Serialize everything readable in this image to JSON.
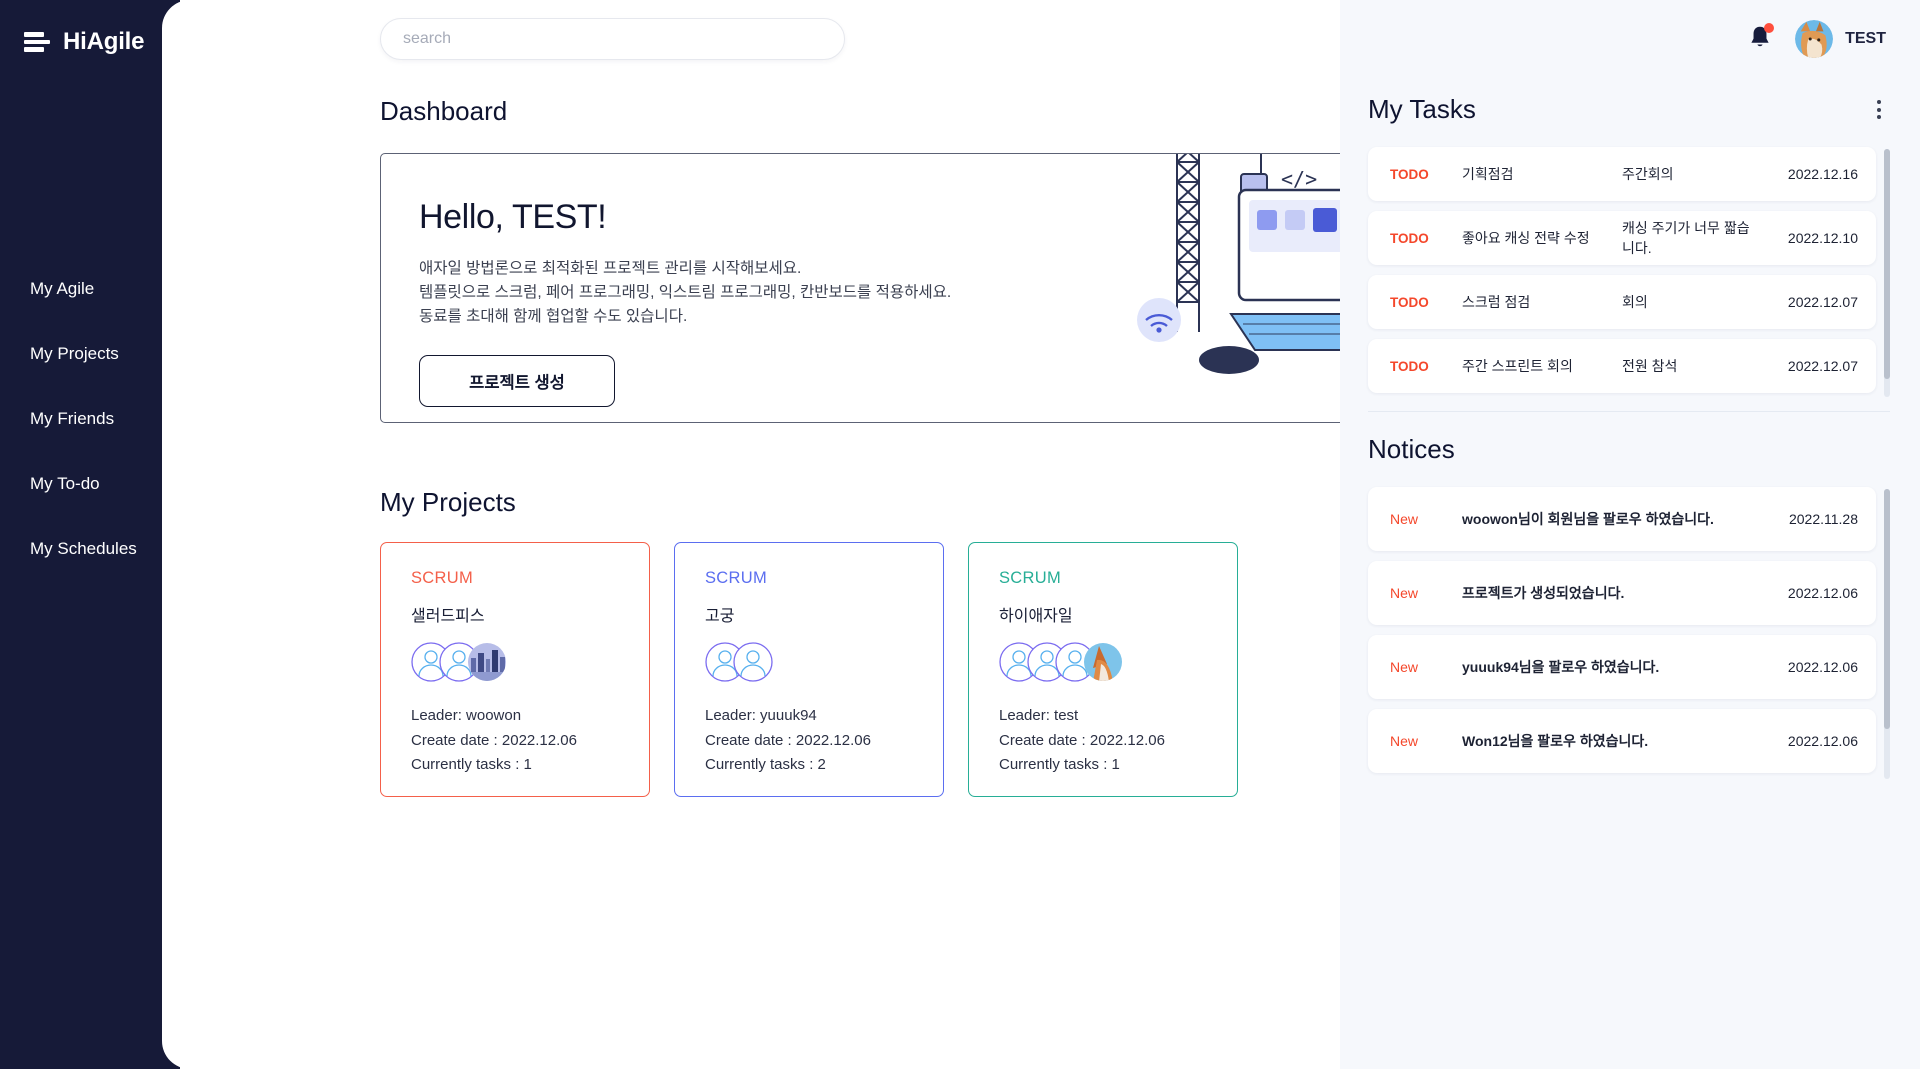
{
  "brand": {
    "name": "HiAgile",
    "icon": "stacked-bars-icon"
  },
  "sidebar": {
    "items": [
      {
        "label": "My Agile"
      },
      {
        "label": "My Projects"
      },
      {
        "label": "My Friends"
      },
      {
        "label": "My To-do"
      },
      {
        "label": "My Schedules"
      }
    ]
  },
  "search": {
    "placeholder": "search",
    "value": ""
  },
  "header": {
    "bell_icon": "bell-icon",
    "notification_badge": true,
    "user_name": "TEST",
    "avatar": "cat-avatar"
  },
  "main": {
    "dashboard_title": "Dashboard",
    "hero": {
      "greeting": "Hello, TEST!",
      "line1": "애자일 방법론으로 최적화된 프로젝트 관리를 시작해보세요.",
      "line2": "템플릿으로 스크럼, 페어 프로그래밍, 익스트림 프로그래밍, 칸반보드를 적용하세요.",
      "line3": "동료를 초대해 함께 협업할 수도 있습니다.",
      "button": "프로젝트 생성"
    },
    "projects_title": "My Projects",
    "projects": [
      {
        "type": "SCRUM",
        "name": "샐러드피스",
        "leader": "Leader: woowon",
        "create_date": "Create date : 2022.12.06",
        "tasks": "Currently tasks : 1",
        "color": "#f4604a",
        "members": 3,
        "photo_avatar": "city-photo"
      },
      {
        "type": "SCRUM",
        "name": "고궁",
        "leader": "Leader: yuuuk94",
        "create_date": "Create date : 2022.12.06",
        "tasks": "Currently tasks : 2",
        "color": "#5b6ef0",
        "members": 2,
        "photo_avatar": ""
      },
      {
        "type": "SCRUM",
        "name": "하이애자일",
        "leader": "Leader: test",
        "create_date": "Create date : 2022.12.06",
        "tasks": "Currently tasks : 1",
        "color": "#27ae96",
        "members": 4,
        "photo_avatar": "cat-photo"
      }
    ]
  },
  "tasks_panel": {
    "title": "My Tasks",
    "menu_icon": "kebab-menu-icon",
    "rows": [
      {
        "status": "TODO",
        "name": "기획점검",
        "note": "주간회의",
        "date": "2022.12.16"
      },
      {
        "status": "TODO",
        "name": "좋아요 캐싱 전략 수정",
        "note": "캐싱 주기가 너무 짧습니다.",
        "date": "2022.12.10"
      },
      {
        "status": "TODO",
        "name": "스크럼 점검",
        "note": "회의",
        "date": "2022.12.07"
      },
      {
        "status": "TODO",
        "name": "주간 스프린트 회의",
        "note": "전원 참석",
        "date": "2022.12.07"
      }
    ]
  },
  "notices_panel": {
    "title": "Notices",
    "rows": [
      {
        "status": "New",
        "text": "woowon님이 회원님을 팔로우 하였습니다.",
        "date": "2022.11.28"
      },
      {
        "status": "New",
        "text": "프로젝트가 생성되었습니다.",
        "date": "2022.12.06"
      },
      {
        "status": "New",
        "text": "yuuuk94님을 팔로우 하였습니다.",
        "date": "2022.12.06"
      },
      {
        "status": "New",
        "text": "Won12님을 팔로우 하였습니다.",
        "date": "2022.12.06"
      }
    ]
  },
  "colors": {
    "sidebar_bg": "#161a38",
    "right_bg": "#f6f8fc",
    "accent_red": "#f4472b",
    "scrum_red": "#f4604a",
    "scrum_blue": "#5b6ef0",
    "scrum_teal": "#27ae96"
  }
}
